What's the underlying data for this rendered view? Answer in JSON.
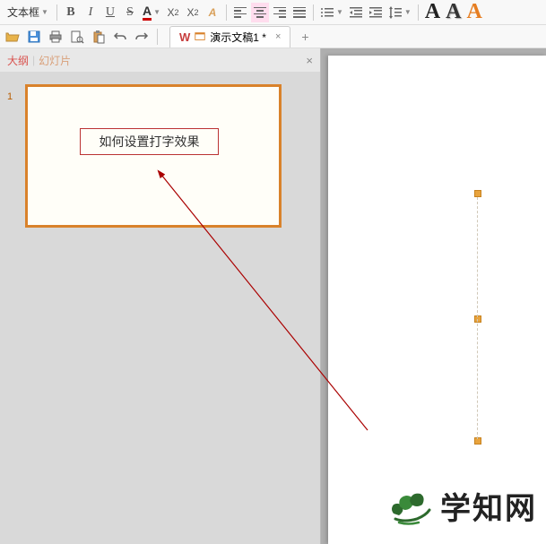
{
  "toolbar": {
    "textbox_label": "文本框",
    "bold": "B",
    "italic": "I",
    "underline": "U",
    "strike": "S",
    "font_color": "A",
    "superscript_base": "X",
    "superscript_sup": "2",
    "subscript_base": "X",
    "subscript_sub": "2",
    "clear_format": "A",
    "big_A": "A"
  },
  "tabs": {
    "doc_title": "演示文稿1 *",
    "w_logo": "W"
  },
  "panel": {
    "tab_outline": "大纲",
    "tab_slides": "幻灯片"
  },
  "slides": [
    {
      "num": "1",
      "textbox": "如何设置打字效果"
    }
  ],
  "watermark": "学知网"
}
